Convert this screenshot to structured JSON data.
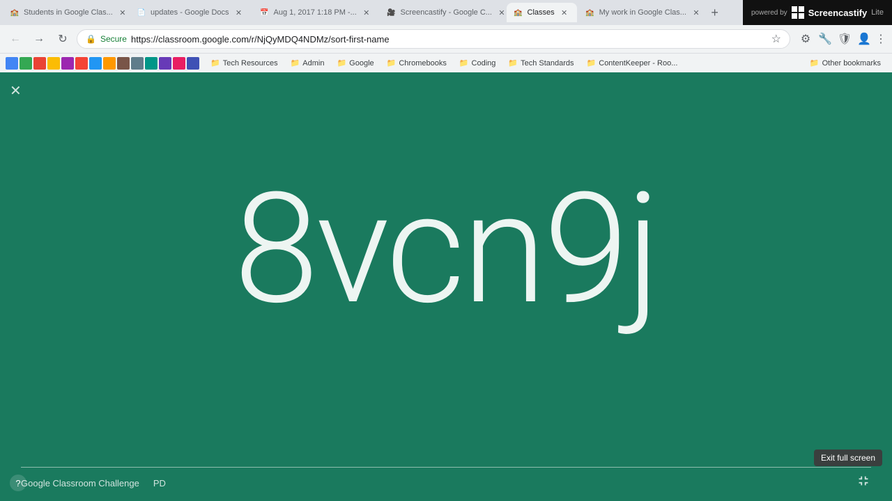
{
  "browser": {
    "tabs": [
      {
        "id": "tab1",
        "label": "Students in Google Clas...",
        "active": false,
        "favicon": "🏫"
      },
      {
        "id": "tab2",
        "label": "updates - Google Docs",
        "active": false,
        "favicon": "📄"
      },
      {
        "id": "tab3",
        "label": "Aug 1, 2017 1:18 PM -...",
        "active": false,
        "favicon": "📅"
      },
      {
        "id": "tab4",
        "label": "Screencastify - Google C...",
        "active": false,
        "favicon": "🎥"
      },
      {
        "id": "tab5",
        "label": "Classes",
        "active": true,
        "favicon": "🏫"
      },
      {
        "id": "tab6",
        "label": "My work in Google Clas...",
        "active": false,
        "favicon": "🏫"
      }
    ],
    "url": "https://classroom.google.com/r/NjQyMDQ4NDMz/sort-first-name",
    "secure_label": "Secure"
  },
  "bookmarks": [
    {
      "label": "Tech Resources",
      "icon": "📁"
    },
    {
      "label": "Admin",
      "icon": "📁"
    },
    {
      "label": "Google",
      "icon": "📁"
    },
    {
      "label": "Chromebooks",
      "icon": "📁"
    },
    {
      "label": "Coding",
      "icon": "📁"
    },
    {
      "label": "Tech Standards",
      "icon": "📁"
    },
    {
      "label": "ContentKeeper - Roo...",
      "icon": "📁"
    },
    {
      "label": "Other bookmarks",
      "icon": "📁"
    }
  ],
  "screencastify": {
    "powered_by": "powered by",
    "name": "Screencastify",
    "edition": "Lite"
  },
  "main": {
    "bg_color": "#1a7a5e",
    "code": "8vcn9j",
    "title": "Google Classroom Challenge",
    "subtitle": "PD",
    "exit_fullscreen_label": "Exit full screen",
    "help_label": "?"
  }
}
